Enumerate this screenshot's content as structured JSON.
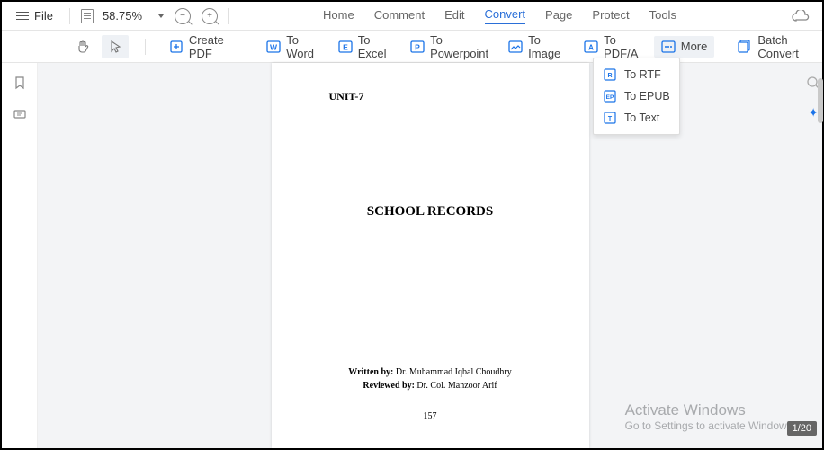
{
  "topbar": {
    "file_label": "File",
    "zoom": "58.75%"
  },
  "tabs": {
    "home": "Home",
    "comment": "Comment",
    "edit": "Edit",
    "convert": "Convert",
    "page": "Page",
    "protect": "Protect",
    "tools": "Tools"
  },
  "toolbar": {
    "create_pdf": "Create PDF",
    "to_word": "To Word",
    "to_excel": "To Excel",
    "to_ppt": "To Powerpoint",
    "to_image": "To Image",
    "to_pdfa": "To PDF/A",
    "more": "More",
    "batch_convert": "Batch Convert"
  },
  "more_menu": {
    "to_rtf": "To RTF",
    "to_epub": "To EPUB",
    "to_text": "To Text"
  },
  "document": {
    "unit": "UNIT-7",
    "title": "SCHOOL RECORDS",
    "written_by_label": "Written by:",
    "written_by": "Dr. Muhammad Iqbal Choudhry",
    "reviewed_by_label": "Reviewed by:",
    "reviewed_by": "Dr. Col. Manzoor Arif",
    "page_number": "157"
  },
  "watermark": {
    "title": "Activate Windows",
    "sub": "Go to Settings to activate Windows."
  },
  "page_indicator": "1/20",
  "colors": {
    "accent": "#2a6fd8",
    "icon_blue": "#1a73e8"
  }
}
